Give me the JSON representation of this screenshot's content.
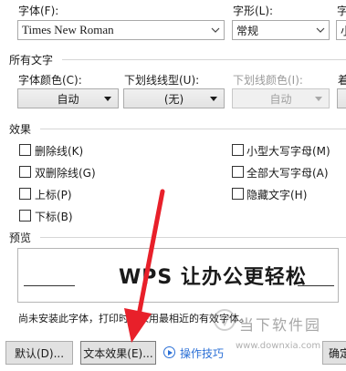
{
  "font": {
    "label": "字体(F):",
    "value": "Times New Roman"
  },
  "style": {
    "label": "字形(L):",
    "value": "常规"
  },
  "size": {
    "label": "字",
    "value": "小"
  },
  "all_text": {
    "section": "所有文字",
    "color_label": "字体颜色(C):",
    "color_value": "自动",
    "underline_label": "下划线线型(U):",
    "underline_value": "(无)",
    "underline_color_label": "下划线颜色(I):",
    "underline_color_value": "自动",
    "emphasis_label": "着"
  },
  "effects": {
    "section": "效果",
    "left": [
      "删除线(K)",
      "双删除线(G)",
      "上标(P)",
      "下标(B)"
    ],
    "right": [
      "小型大写字母(M)",
      "全部大写字母(A)",
      "隐藏文字(H)"
    ]
  },
  "preview": {
    "section": "预览",
    "text": "WPS 让办公更轻松"
  },
  "note": "尚未安装此字体，打印时将采用最相近的有效字体。",
  "buttons": {
    "default": "默认(D)...",
    "text_effects": "文本效果(E)...",
    "tips": "操作技巧",
    "ok": "确定"
  },
  "watermark": {
    "name": "当下软件园",
    "url": "www.downxia.com"
  },
  "colors": {
    "arrow": "#e8202a",
    "tips": "#2a6fd6"
  }
}
